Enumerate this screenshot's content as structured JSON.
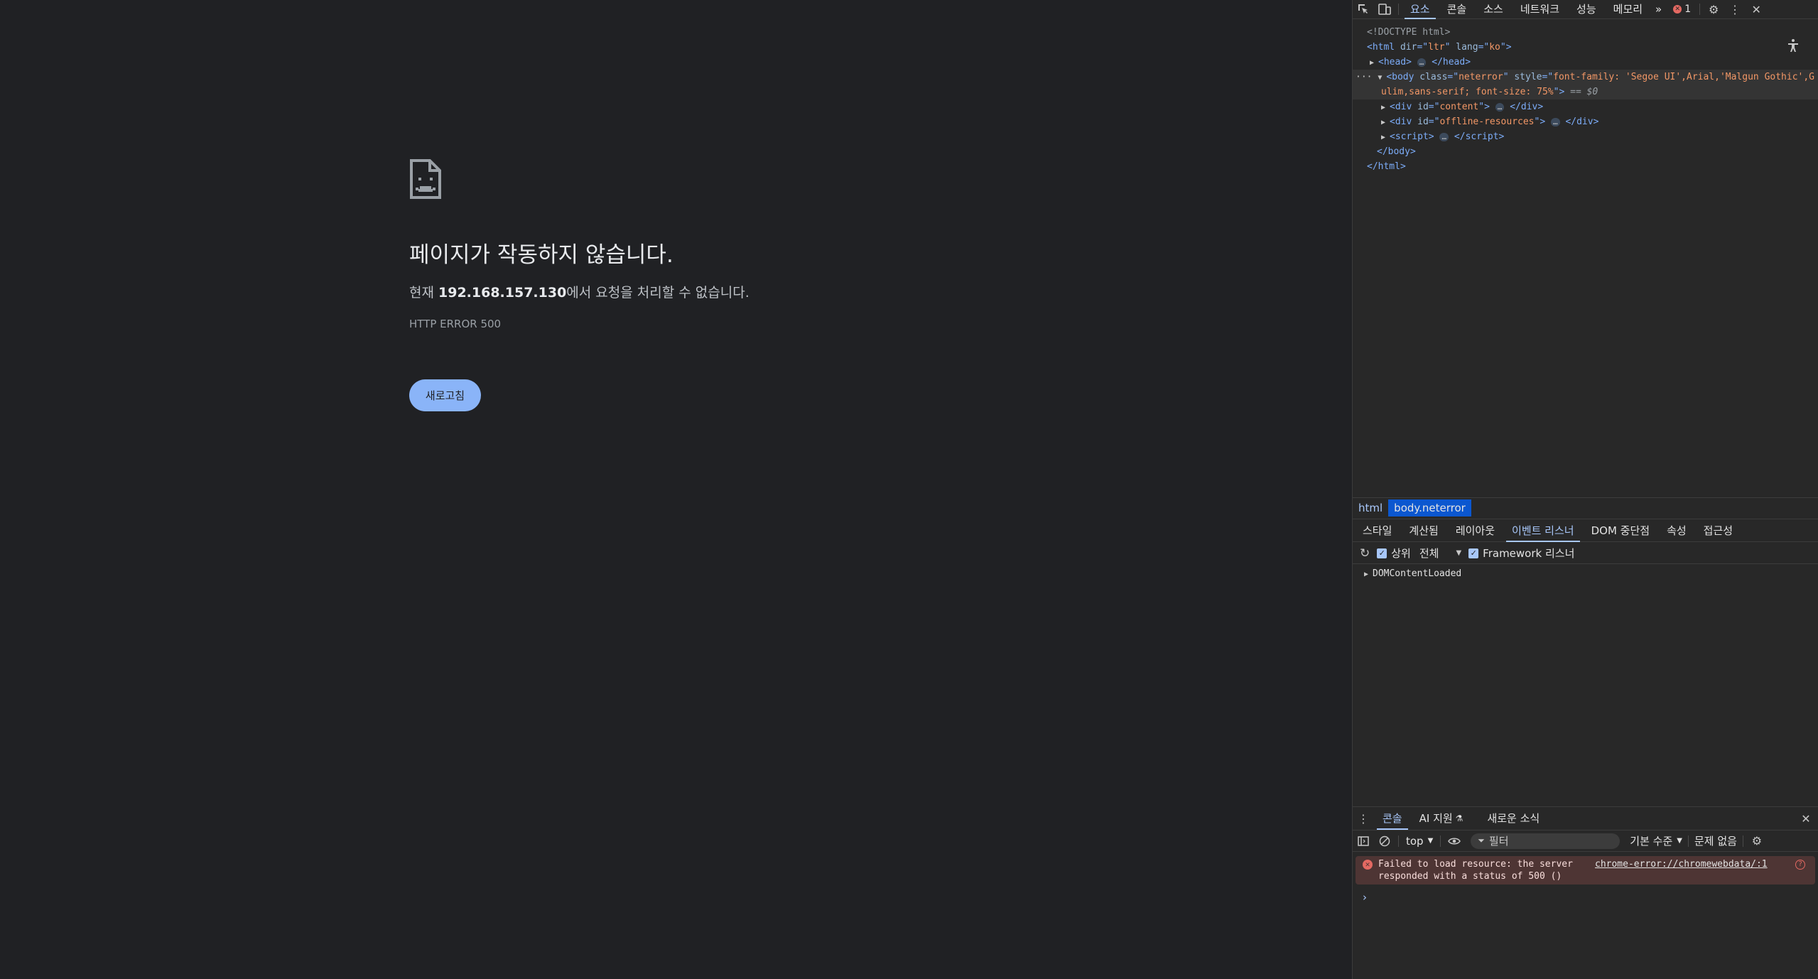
{
  "error_page": {
    "icon": "sad-document-icon",
    "title": "페이지가 작동하지 않습니다.",
    "desc_prefix": "현재 ",
    "host": "192.168.157.130",
    "desc_suffix": "에서 요청을 처리할 수 없습니다.",
    "error_code": "HTTP ERROR 500",
    "reload_label": "새로고침",
    "colors": {
      "background": "#202124",
      "button": "#8ab4f8"
    }
  },
  "devtools": {
    "main_tabs": [
      "요소",
      "콘솔",
      "소스",
      "네트워크",
      "성능",
      "메모리"
    ],
    "more_tabs": "»",
    "error_count": "1",
    "dom": {
      "doctype": "<!DOCTYPE html>",
      "html_open_tag": "html",
      "html_dir_attr": "dir",
      "html_dir_val": "ltr",
      "html_lang_attr": "lang",
      "html_lang_val": "ko",
      "head": "head",
      "body_class_attr": "class",
      "body_class_val": "neterror",
      "body_style_attr": "style",
      "body_style_val": "font-family: 'Segoe UI',Arial,'Malgun Gothic',G",
      "body_style_val2": "ulim,sans-serif; font-size: 75%",
      "eq0": "== $0",
      "div1_id": "content",
      "div2_id": "offline-resources",
      "script": "script",
      "body_close": "</body>",
      "html_close": "</html>"
    },
    "breadcrumb": [
      "html",
      "body.neterror"
    ],
    "side_tabs": [
      "스타일",
      "계산됨",
      "레이아웃",
      "이벤트 리스너",
      "DOM 중단점",
      "속성",
      "접근성"
    ],
    "side_active": "이벤트 리스너",
    "listener_bar": {
      "ancestors_label": "상위",
      "scope_value": "전체",
      "framework_label": "Framework 리스너"
    },
    "listeners": [
      "DOMContentLoaded"
    ],
    "drawer_tabs": [
      "콘솔",
      "AI 지원",
      "새로운 소식"
    ],
    "console_bar": {
      "context": "top",
      "filter_placeholder": "필터",
      "levels": "기본 수준",
      "issues": "문제 없음"
    },
    "console_messages": [
      {
        "level": "error",
        "text": "Failed to load resource: the server\nresponded with a status of 500 ()",
        "source": "chrome-error://chromewebdata/:1"
      }
    ],
    "colors": {
      "accent": "#a8c7fa",
      "error_bg": "#4e3534",
      "error": "#e46962"
    }
  }
}
